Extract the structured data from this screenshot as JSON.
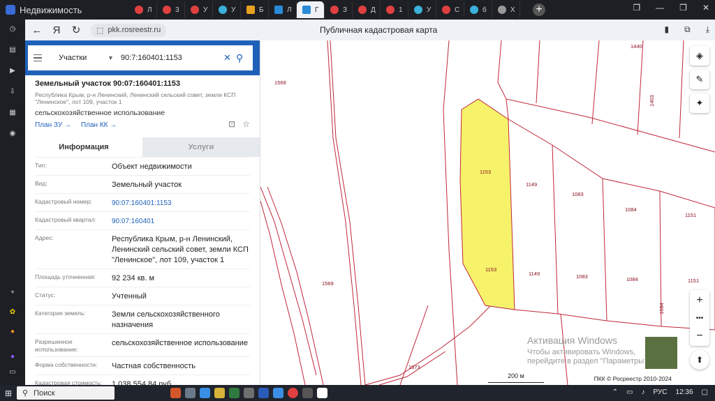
{
  "browser": {
    "brand": "Недвижимость",
    "tabs": [
      "Л",
      "3",
      "У",
      "У",
      "Б",
      "Л",
      "Г",
      "З",
      "Д",
      "1",
      "У",
      "С",
      "б",
      "Х"
    ],
    "url": "pkk.rosreestr.ru",
    "page_title": "Публичная кадастровая карта"
  },
  "search": {
    "mode": "Участки",
    "query": "90:7:160401:1153"
  },
  "object": {
    "title": "Земельный участок 90:07:160401:1153",
    "address_short": "Республика Крым, р-н Ленинский, Ленинский сельский совет, земли КСП \"Ленинское\", лот 109, участок 1",
    "use": "сельскохозяйственное использование",
    "link_plan_zu": "План ЗУ →",
    "link_plan_kk": "План КК →"
  },
  "panel_tabs": {
    "info": "Информация",
    "services": "Услуги"
  },
  "rows": [
    {
      "k": "Тип:",
      "v": "Объект недвижимости"
    },
    {
      "k": "Вид:",
      "v": "Земельный участок"
    },
    {
      "k": "Кадастровый номер:",
      "v": "90:07:160401:1153"
    },
    {
      "k": "Кадастровый квартал:",
      "v": "90:07:160401"
    },
    {
      "k": "Адрес:",
      "v": "Республика Крым, р-н Ленинский, Ленинский сельский совет, земли КСП \"Ленинское\", лот 109, участок 1"
    },
    {
      "k": "Площадь уточненная:",
      "v": "92 234 кв. м"
    },
    {
      "k": "Статус:",
      "v": "Учтенный"
    },
    {
      "k": "Категория земель:",
      "v": "Земли сельскохозяйственного назначения"
    },
    {
      "k": "Разрешенное использование:",
      "v": "сельскохозяйственное использование"
    },
    {
      "k": "Форма собственности:",
      "v": "Частная собственность"
    },
    {
      "k": "Кадастровая стоимость:",
      "v": "1 038 554,84 руб."
    }
  ],
  "map": {
    "parcel_labels": [
      "1440",
      "1569",
      "1403",
      "1153",
      "1149",
      "1083",
      "1084",
      "1151",
      "1153",
      "1149",
      "1083",
      "1084",
      "1151",
      "1569",
      "1084",
      "1573"
    ],
    "scale": "200 м",
    "copyright": "ПКК © Росреестр 2010-2024",
    "activation_title": "Активация Windows",
    "activation_text": "Чтобы активировать Windows, перейдите в раздел \"Параметры\"."
  },
  "taskbar": {
    "search": "Поиск",
    "lang": "РУС",
    "time": "12:36"
  },
  "colors": {
    "accent": "#1f61b8",
    "parcel_line": "#c0263a",
    "selected_fill": "#f6f36b"
  }
}
